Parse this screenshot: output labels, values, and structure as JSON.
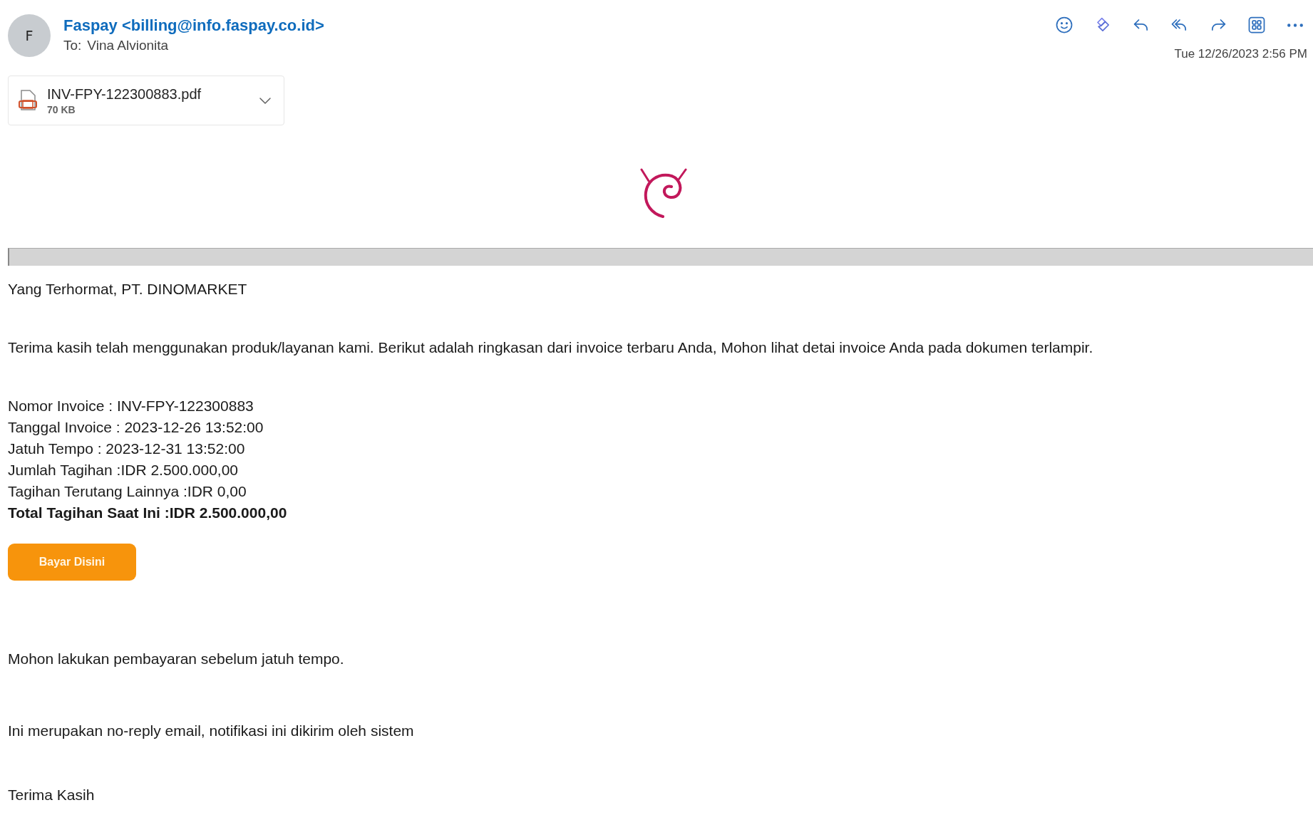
{
  "header": {
    "avatar_initial": "F",
    "sender": "Faspay <billing@info.faspay.co.id>",
    "to_label": "To:",
    "recipient": "Vina Alvionita",
    "date": "Tue 12/26/2023 2:56 PM"
  },
  "attachment": {
    "name": "INV-FPY-122300883.pdf",
    "size": "70 KB"
  },
  "body": {
    "greeting": "Yang Terhormat, PT. DINOMARKET",
    "intro": "Terima kasih telah menggunakan produk/layanan kami. Berikut adalah ringkasan dari invoice terbaru Anda, Mohon lihat detai invoice Anda pada dokumen terlampir.",
    "invoice_lines": [
      {
        "text": "Nomor Invoice : INV-FPY-122300883",
        "bold": false
      },
      {
        "text": "Tanggal Invoice : 2023-12-26 13:52:00",
        "bold": false
      },
      {
        "text": "Jatuh Tempo : 2023-12-31 13:52:00",
        "bold": false
      },
      {
        "text": "Jumlah Tagihan :IDR 2.500.000,00",
        "bold": false
      },
      {
        "text": "Tagihan Terutang Lainnya :IDR 0,00",
        "bold": false
      },
      {
        "text": "Total Tagihan Saat Ini :IDR 2.500.000,00",
        "bold": true
      }
    ],
    "pay_button": "Bayar Disini",
    "reminder": "Mohon lakukan pembayaran sebelum jatuh tempo.",
    "notice": "Ini merupakan no-reply email, notifikasi ini dikirim oleh sistem",
    "closing": "Terima Kasih"
  }
}
